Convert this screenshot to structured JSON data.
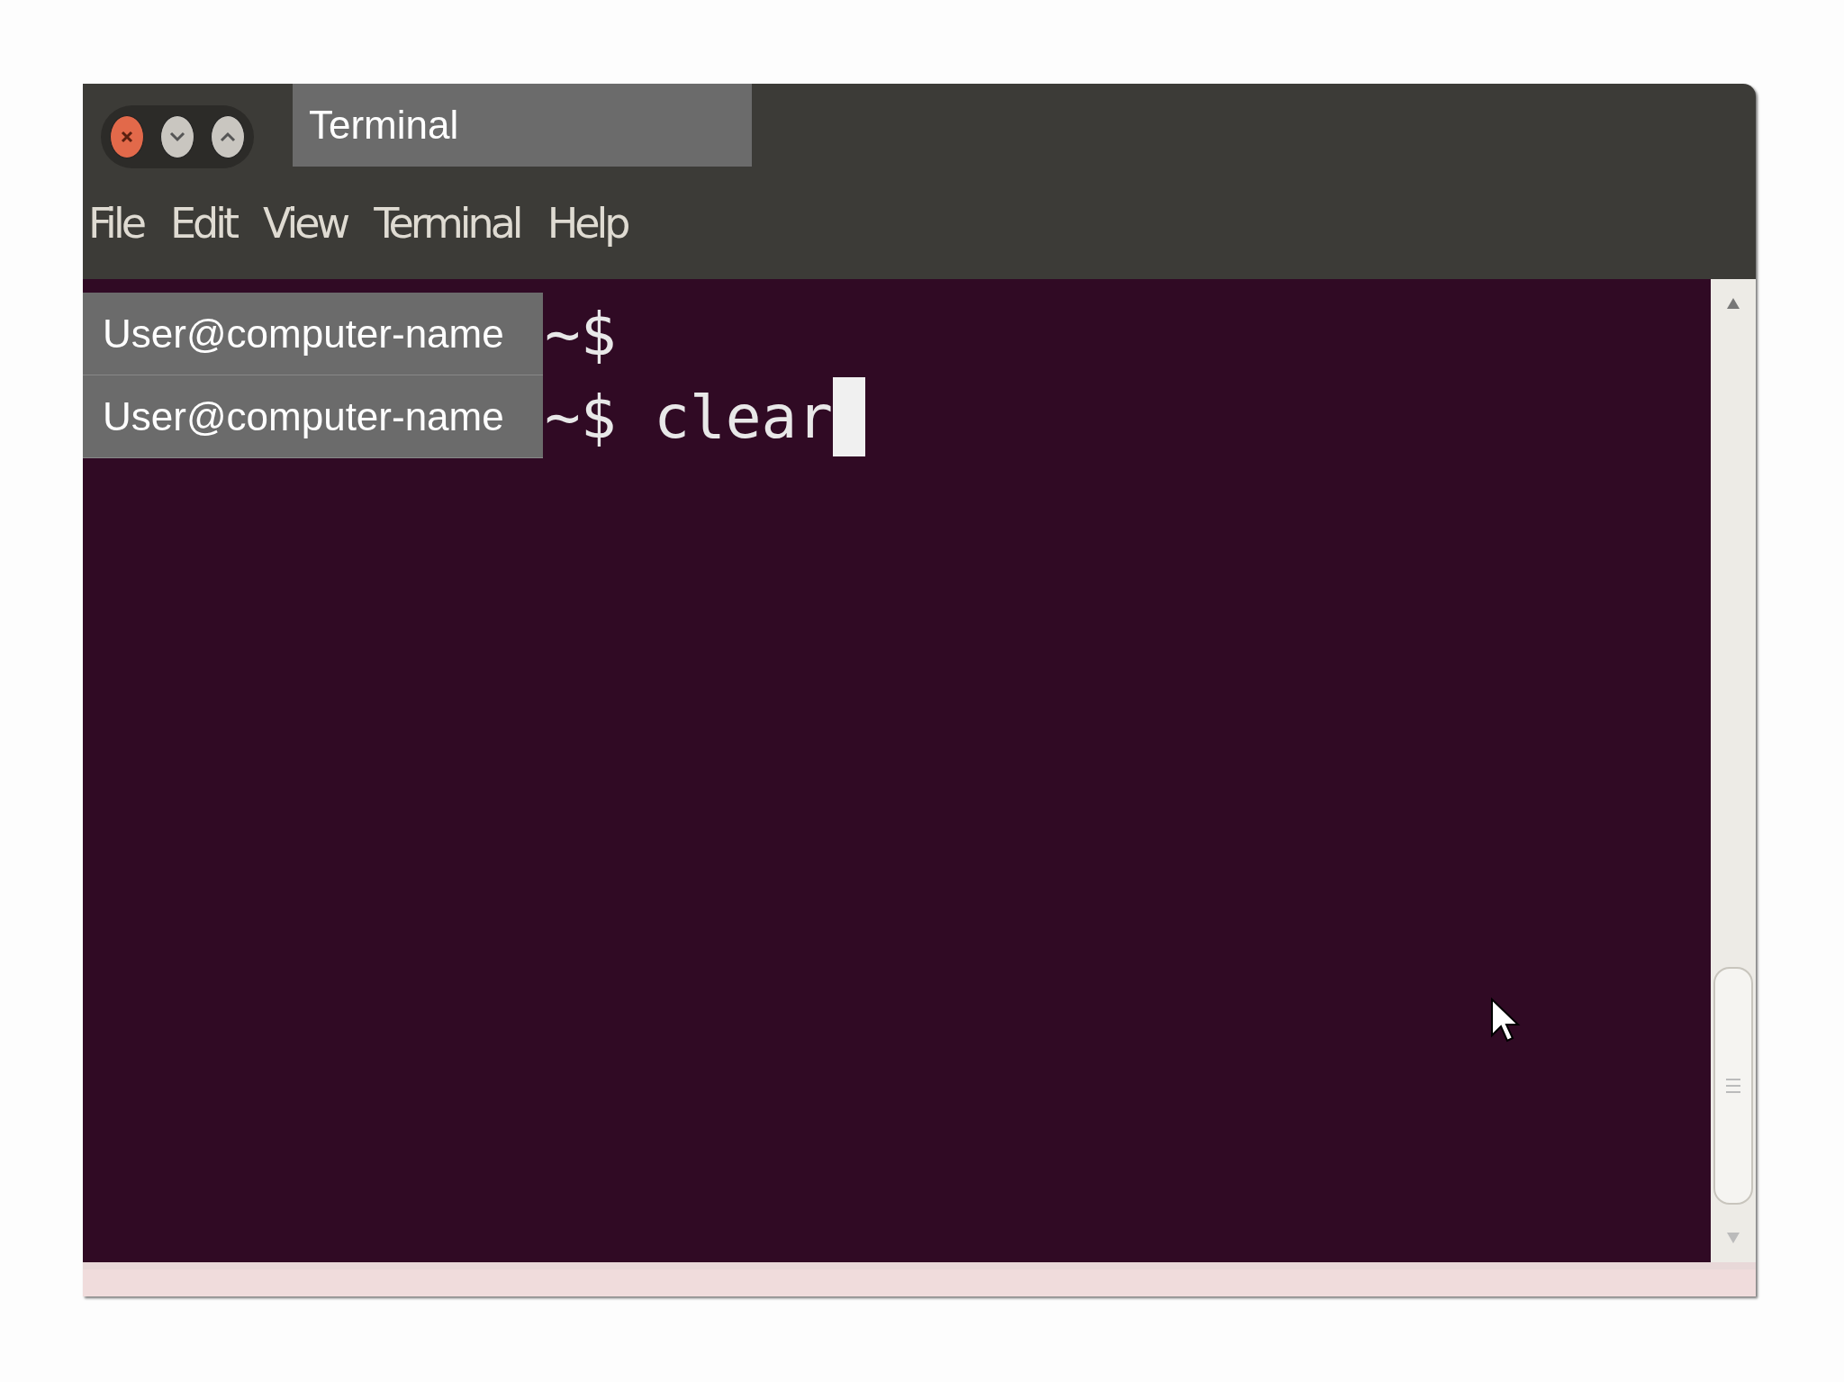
{
  "window": {
    "title": "Terminal"
  },
  "menu": [
    {
      "label": "File"
    },
    {
      "label": "Edit"
    },
    {
      "label": "View"
    },
    {
      "label": "Terminal"
    },
    {
      "label": "Help"
    }
  ],
  "lines": [
    {
      "user": "User@computer-name",
      "prompt": "~$",
      "cursor": false
    },
    {
      "user": "User@computer-name",
      "prompt": "~$",
      "command": "clear",
      "cursor": true
    }
  ]
}
